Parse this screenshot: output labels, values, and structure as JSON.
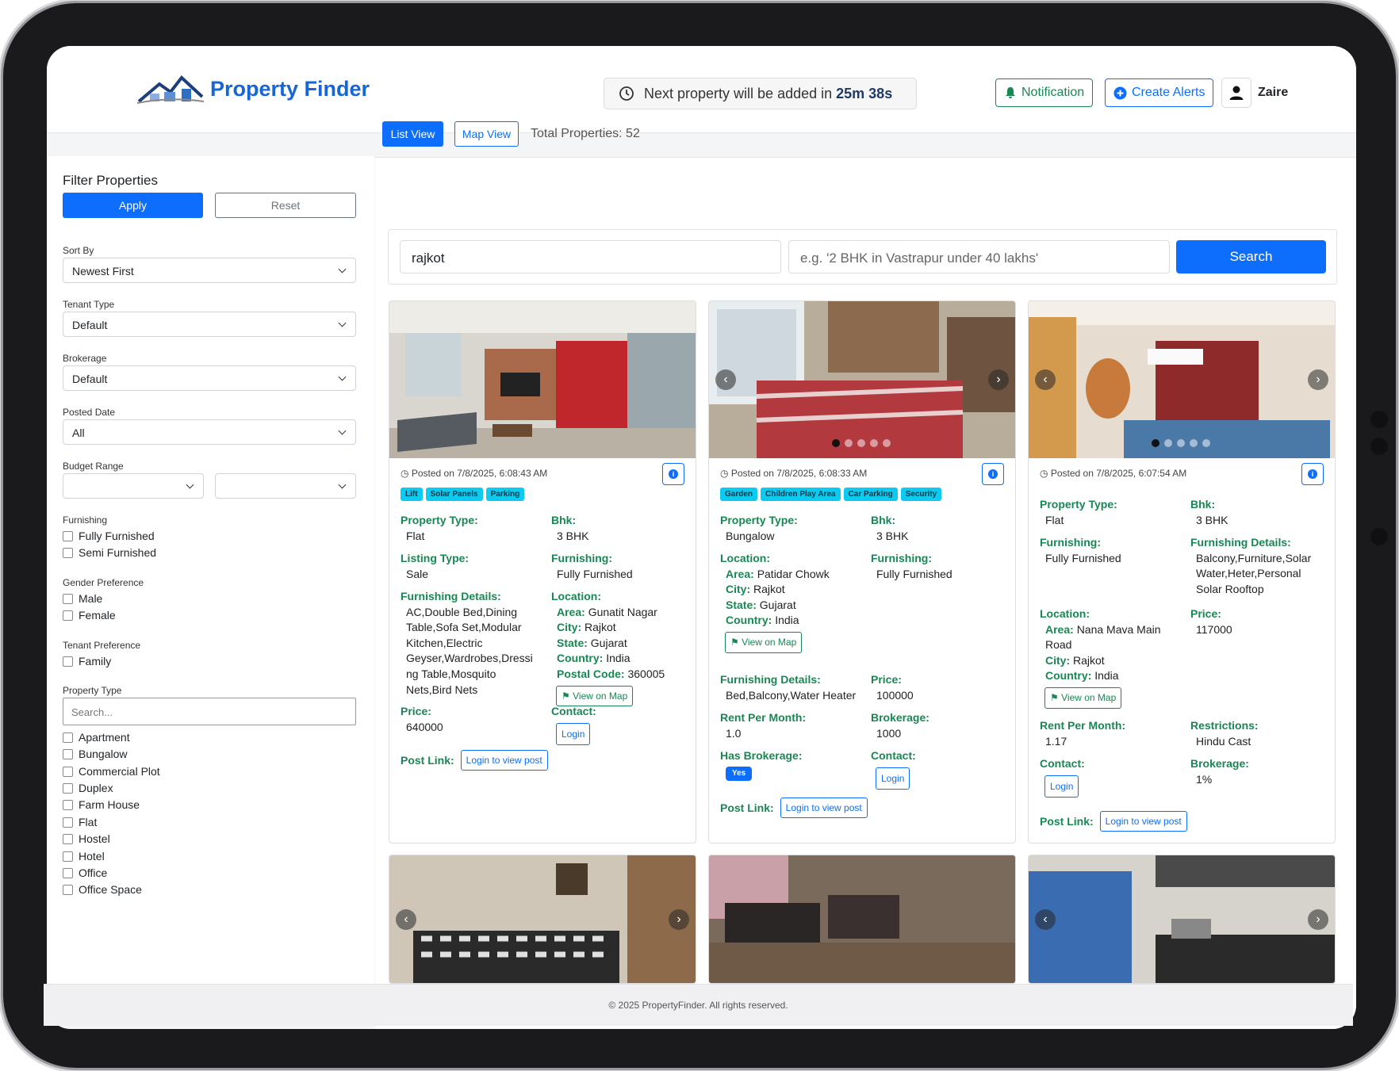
{
  "header": {
    "logo_text": "Property Finder",
    "timer_prefix": "Next property will be added in",
    "timer_value": "25m 38s",
    "notification_label": "Notification",
    "create_alerts_label": "Create Alerts",
    "user_name": "Zaire"
  },
  "sidebar": {
    "title": "Filter Properties",
    "apply_label": "Apply",
    "reset_label": "Reset",
    "sort_by": {
      "label": "Sort By",
      "value": "Newest First"
    },
    "tenant_type": {
      "label": "Tenant Type",
      "value": "Default"
    },
    "brokerage": {
      "label": "Brokerage",
      "value": "Default"
    },
    "posted_date": {
      "label": "Posted Date",
      "value": "All"
    },
    "budget_range": {
      "label": "Budget Range",
      "min": "",
      "max": ""
    },
    "furnishing": {
      "label": "Furnishing",
      "options": [
        "Fully Furnished",
        "Semi Furnished"
      ]
    },
    "gender": {
      "label": "Gender Preference",
      "options": [
        "Male",
        "Female"
      ]
    },
    "tenant_pref": {
      "label": "Tenant Preference",
      "options": [
        "Family"
      ]
    },
    "property_type": {
      "label": "Property Type",
      "search_placeholder": "Search...",
      "options": [
        "Apartment",
        "Bungalow",
        "Commercial Plot",
        "Duplex",
        "Farm House",
        "Flat",
        "Hostel",
        "Hotel",
        "Office",
        "Office Space"
      ]
    }
  },
  "main": {
    "list_view_label": "List View",
    "map_view_label": "Map View",
    "total_label": "Total Properties: 52",
    "location_value": "rajkot",
    "query_placeholder": "e.g. '2 BHK in Vastrapur under 40 lakhs'",
    "search_label": "Search"
  },
  "labels": {
    "property_type": "Property Type:",
    "bhk": "Bhk:",
    "listing_type": "Listing Type:",
    "furnishing": "Furnishing:",
    "furnishing_details": "Furnishing Details:",
    "location": "Location:",
    "area": "Area:",
    "city": "City:",
    "state": "State:",
    "country": "Country:",
    "postal_code": "Postal Code:",
    "price": "Price:",
    "contact": "Contact:",
    "post_link": "Post Link:",
    "rent_per_month": "Rent Per Month:",
    "brokerage": "Brokerage:",
    "has_brokerage": "Has Brokerage:",
    "restrictions": "Restrictions:",
    "view_on_map": "View on Map",
    "login": "Login",
    "login_to_view": "Login to view post",
    "yes": "Yes"
  },
  "cards": [
    {
      "posted": "Posted on 7/8/2025, 6:08:43 AM",
      "tags": [
        "Lift",
        "Solar Panels",
        "Parking"
      ],
      "property_type": "Flat",
      "bhk": "3 BHK",
      "listing_type": "Sale",
      "furnishing": "Fully Furnished",
      "furnishing_details": "AC,Double Bed,Dining Table,Sofa Set,Modular Kitchen,Electric Geyser,Wardrobes,Dressi ng Table,Mosquito Nets,Bird Nets",
      "area": "Gunatit Nagar",
      "city": "Rajkot",
      "state": "Gujarat",
      "country": "India",
      "postal_code": "360005",
      "price": "640000"
    },
    {
      "posted": "Posted on 7/8/2025, 6:08:33 AM",
      "tags": [
        "Garden",
        "Children Play Area",
        "Car Parking",
        "Security"
      ],
      "property_type": "Bungalow",
      "bhk": "3 BHK",
      "furnishing": "Fully Furnished",
      "area": "Patidar Chowk",
      "city": "Rajkot",
      "state": "Gujarat",
      "country": "India",
      "furnishing_details": "Bed,Balcony,Water Heater",
      "price": "100000",
      "rent_per_month": "1.0",
      "brokerage": "1000"
    },
    {
      "posted": "Posted on 7/8/2025, 6:07:54 AM",
      "property_type": "Flat",
      "bhk": "3 BHK",
      "furnishing": "Fully Furnished",
      "furnishing_details": "Balcony,Furniture,Solar Water,Heter,Personal Solar Rooftop",
      "area": "Nana Mava Main Road",
      "city": "Rajkot",
      "country": "India",
      "price": "117000",
      "rent_per_month": "1.17",
      "restrictions": "Hindu Cast",
      "brokerage": "1%"
    }
  ],
  "footer": "© 2025 PropertyFinder. All rights reserved."
}
